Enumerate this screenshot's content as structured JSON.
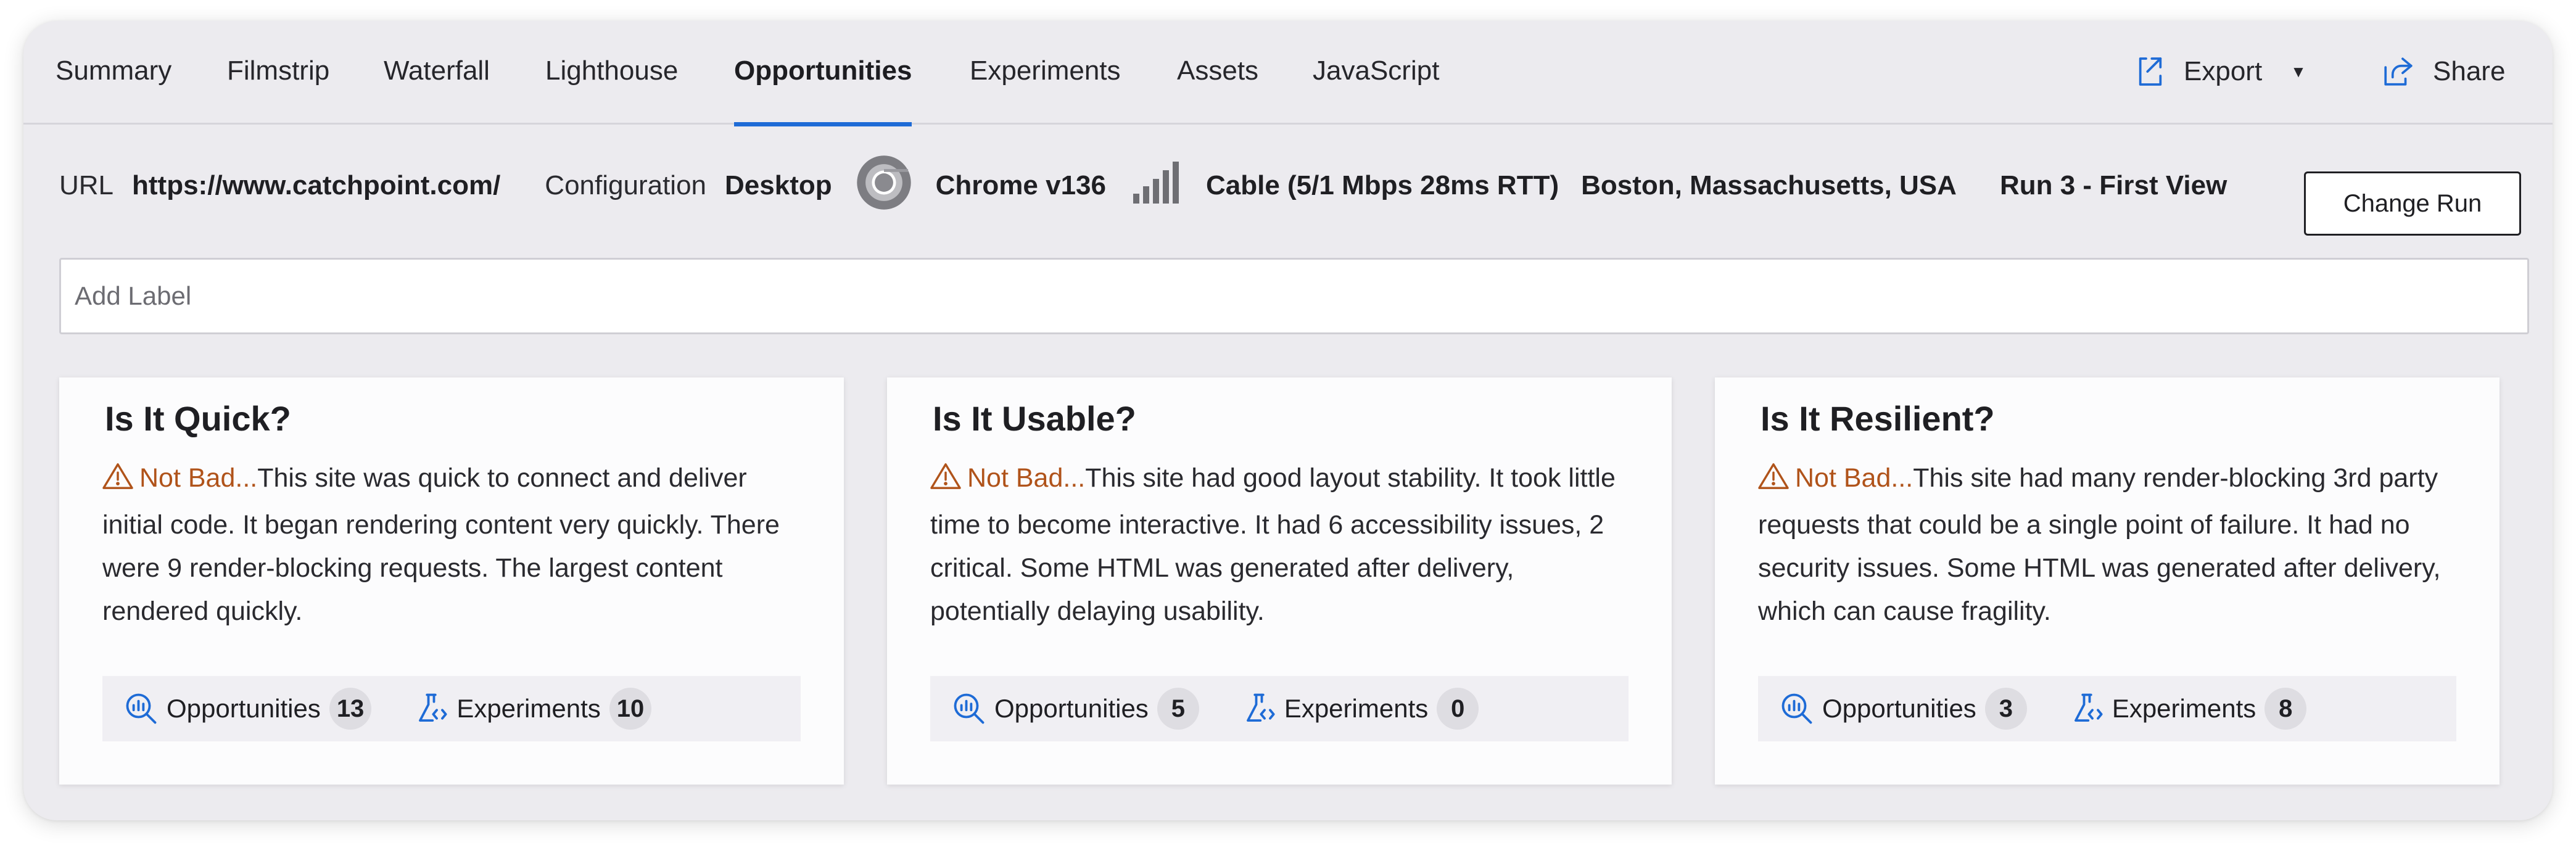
{
  "tabs": [
    {
      "label": "Summary"
    },
    {
      "label": "Filmstrip"
    },
    {
      "label": "Waterfall"
    },
    {
      "label": "Lighthouse"
    },
    {
      "label": "Opportunities",
      "active": true
    },
    {
      "label": "Experiments"
    },
    {
      "label": "Assets"
    },
    {
      "label": "JavaScript"
    }
  ],
  "actions": {
    "export_label": "Export",
    "share_label": "Share"
  },
  "info": {
    "url_label": "URL",
    "url_value": "https://www.catchpoint.com/",
    "config_label": "Configuration",
    "device": "Desktop",
    "browser": "Chrome v136",
    "connection": "Cable (5/1 Mbps 28ms RTT)",
    "location": "Boston, Massachusetts, USA",
    "run": "Run 3 - First View",
    "change_run_label": "Change Run"
  },
  "label_input": {
    "placeholder": "Add Label",
    "value": ""
  },
  "cards": [
    {
      "title": "Is It Quick?",
      "status": "Not Bad...",
      "summary": "This site was quick to connect and deliver initial code. It began rendering content very quickly. There were 9 render-blocking requests. The largest content rendered quickly.",
      "opportunities_label": "Opportunities",
      "opportunities_count": "13",
      "experiments_label": "Experiments",
      "experiments_count": "10"
    },
    {
      "title": "Is It Usable?",
      "status": "Not Bad...",
      "summary": "This site had good layout stability. It took little time to become interactive. It had 6 accessibility issues, 2 critical. Some HTML was generated after delivery, potentially delaying usability.",
      "opportunities_label": "Opportunities",
      "opportunities_count": "5",
      "experiments_label": "Experiments",
      "experiments_count": "0"
    },
    {
      "title": "Is It Resilient?",
      "status": "Not Bad...",
      "summary": "This site had many render-blocking 3rd party requests that could be a single point of failure. It had no security issues. Some HTML was generated after delivery, which can cause fragility.",
      "opportunities_label": "Opportunities",
      "opportunities_count": "3",
      "experiments_label": "Experiments",
      "experiments_count": "8"
    }
  ],
  "colors": {
    "accent": "#1e6bd6",
    "status_warning": "#b0531a",
    "frame_bg": "#ecebef",
    "card_bg": "#fcfcfd"
  },
  "icons": {
    "export": "export-icon",
    "export_caret": "caret-down-icon",
    "share": "share-icon",
    "browser": "chrome-icon",
    "connection": "signal-bars-icon",
    "status": "warning-triangle-icon",
    "opportunities": "magnifier-chart-icon",
    "experiments": "flask-code-icon"
  }
}
